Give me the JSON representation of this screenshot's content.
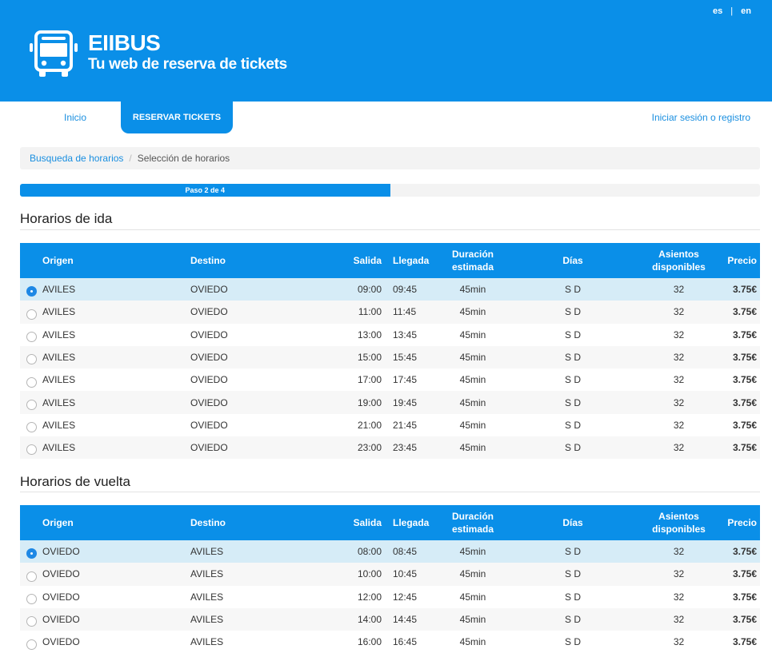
{
  "header": {
    "brand": "EIIBUS",
    "tagline": "Tu web de reserva de tickets",
    "lang": [
      "es",
      "en"
    ],
    "lang_separator": "|"
  },
  "nav": {
    "inicio": "Inicio",
    "reservar": "RESERVAR TICKETS",
    "login": "Iniciar sesión o registro"
  },
  "breadcrumb": {
    "link": "Busqueda de horarios",
    "separator": "/",
    "current": "Selección de horarios"
  },
  "progress": {
    "label": "Paso 2 de 4",
    "value": 0.5
  },
  "table_headers": {
    "origen": "Origen",
    "destino": "Destino",
    "salida": "Salida",
    "llegada": "Llegada",
    "duracion": "Duración estimada",
    "dias": "Días",
    "asientos": "Asientos disponibles",
    "precio": "Precio"
  },
  "ida": {
    "title": "Horarios de ida",
    "rows": [
      {
        "selected": true,
        "origen": "AVILES",
        "destino": "OVIEDO",
        "salida": "09:00",
        "llegada": "09:45",
        "duracion": "45min",
        "dias": "S D",
        "asientos": "32",
        "precio": "3.75€"
      },
      {
        "selected": false,
        "origen": "AVILES",
        "destino": "OVIEDO",
        "salida": "11:00",
        "llegada": "11:45",
        "duracion": "45min",
        "dias": "S D",
        "asientos": "32",
        "precio": "3.75€"
      },
      {
        "selected": false,
        "origen": "AVILES",
        "destino": "OVIEDO",
        "salida": "13:00",
        "llegada": "13:45",
        "duracion": "45min",
        "dias": "S D",
        "asientos": "32",
        "precio": "3.75€"
      },
      {
        "selected": false,
        "origen": "AVILES",
        "destino": "OVIEDO",
        "salida": "15:00",
        "llegada": "15:45",
        "duracion": "45min",
        "dias": "S D",
        "asientos": "32",
        "precio": "3.75€"
      },
      {
        "selected": false,
        "origen": "AVILES",
        "destino": "OVIEDO",
        "salida": "17:00",
        "llegada": "17:45",
        "duracion": "45min",
        "dias": "S D",
        "asientos": "32",
        "precio": "3.75€"
      },
      {
        "selected": false,
        "origen": "AVILES",
        "destino": "OVIEDO",
        "salida": "19:00",
        "llegada": "19:45",
        "duracion": "45min",
        "dias": "S D",
        "asientos": "32",
        "precio": "3.75€"
      },
      {
        "selected": false,
        "origen": "AVILES",
        "destino": "OVIEDO",
        "salida": "21:00",
        "llegada": "21:45",
        "duracion": "45min",
        "dias": "S D",
        "asientos": "32",
        "precio": "3.75€"
      },
      {
        "selected": false,
        "origen": "AVILES",
        "destino": "OVIEDO",
        "salida": "23:00",
        "llegada": "23:45",
        "duracion": "45min",
        "dias": "S D",
        "asientos": "32",
        "precio": "3.75€"
      }
    ]
  },
  "vuelta": {
    "title": "Horarios de vuelta",
    "rows": [
      {
        "selected": true,
        "origen": "OVIEDO",
        "destino": "AVILES",
        "salida": "08:00",
        "llegada": "08:45",
        "duracion": "45min",
        "dias": "S D",
        "asientos": "32",
        "precio": "3.75€"
      },
      {
        "selected": false,
        "origen": "OVIEDO",
        "destino": "AVILES",
        "salida": "10:00",
        "llegada": "10:45",
        "duracion": "45min",
        "dias": "S D",
        "asientos": "32",
        "precio": "3.75€"
      },
      {
        "selected": false,
        "origen": "OVIEDO",
        "destino": "AVILES",
        "salida": "12:00",
        "llegada": "12:45",
        "duracion": "45min",
        "dias": "S D",
        "asientos": "32",
        "precio": "3.75€"
      },
      {
        "selected": false,
        "origen": "OVIEDO",
        "destino": "AVILES",
        "salida": "14:00",
        "llegada": "14:45",
        "duracion": "45min",
        "dias": "S D",
        "asientos": "32",
        "precio": "3.75€"
      },
      {
        "selected": false,
        "origen": "OVIEDO",
        "destino": "AVILES",
        "salida": "16:00",
        "llegada": "16:45",
        "duracion": "45min",
        "dias": "S D",
        "asientos": "32",
        "precio": "3.75€"
      }
    ]
  },
  "icons": {
    "logo": "bus-icon",
    "radio": "radio-button"
  },
  "colors": {
    "primary": "#0a8fe8",
    "link": "#1a8fe0",
    "selected_row": "#d6ecf7",
    "radio_on": "#1e88e5"
  }
}
